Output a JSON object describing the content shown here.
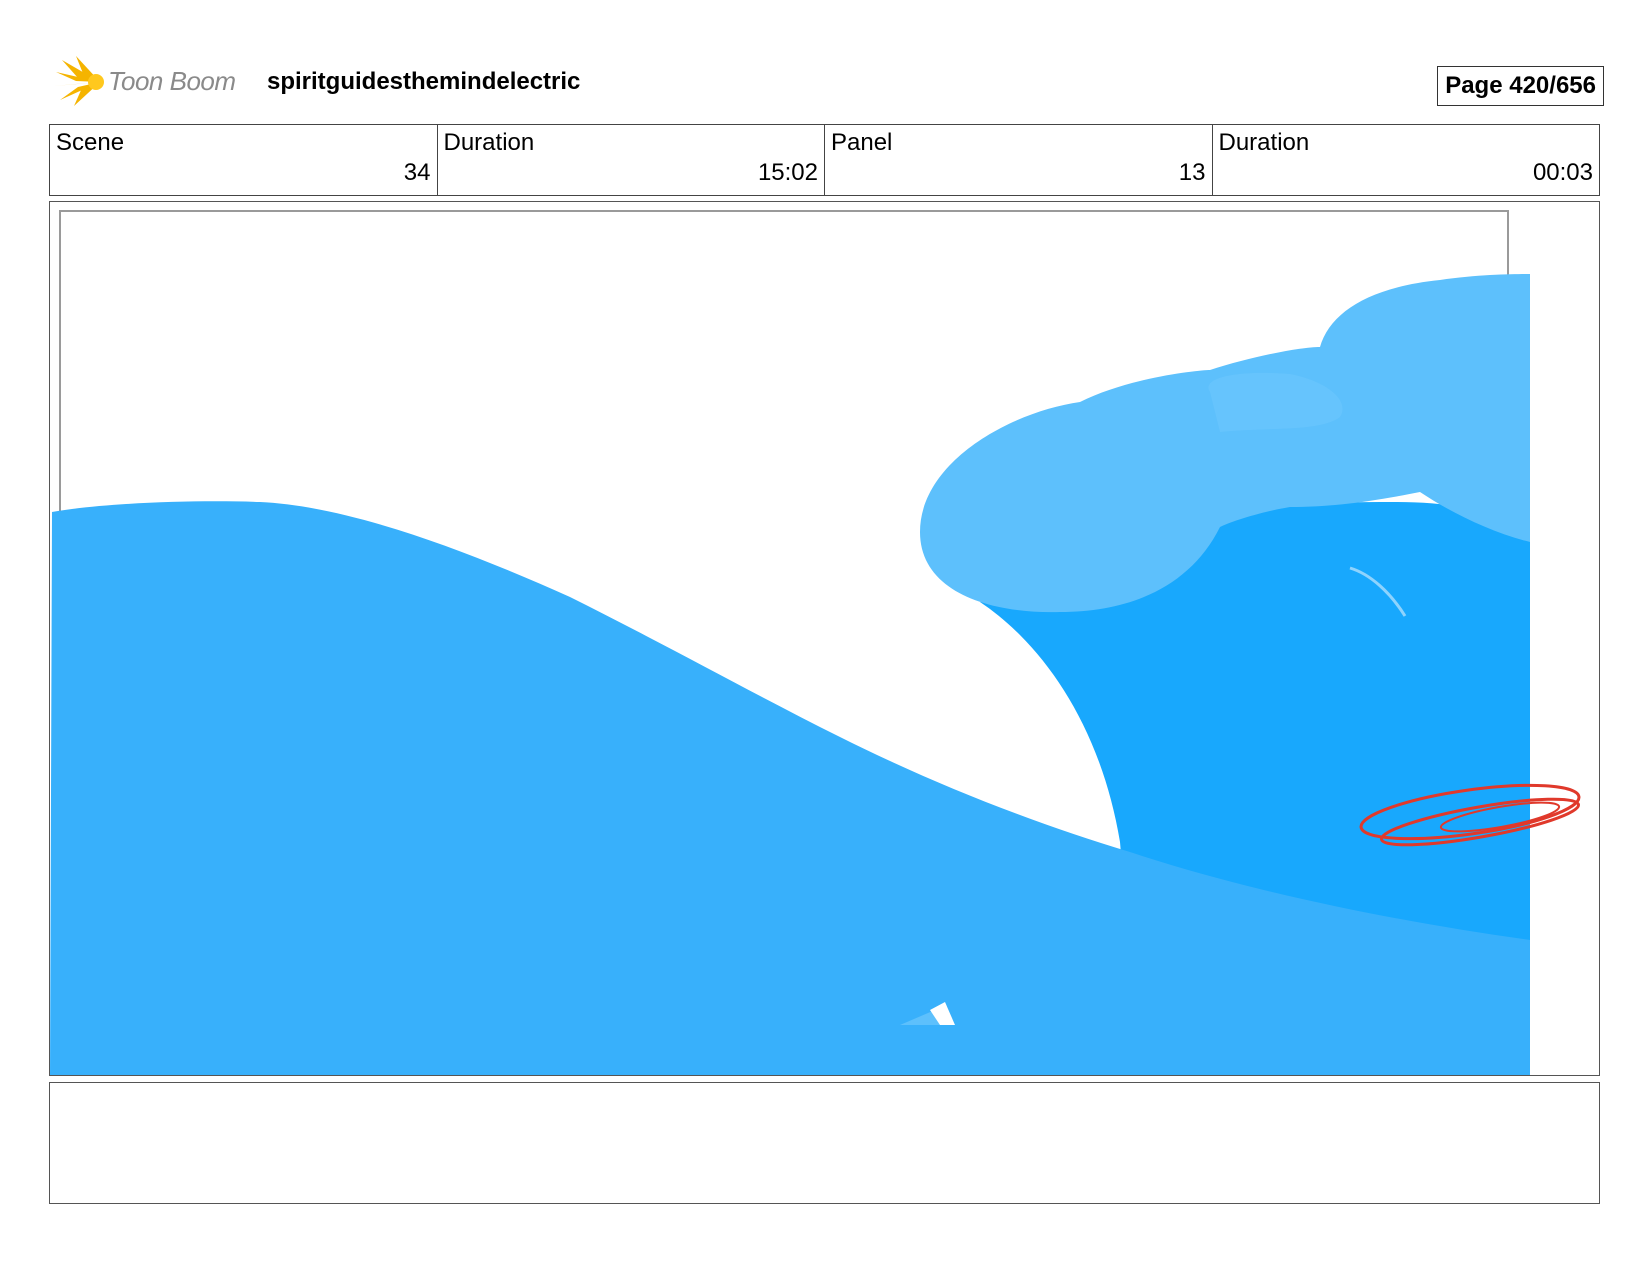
{
  "header": {
    "logo": {
      "text": "Toon Boom",
      "icon": "starburst-logo-icon"
    },
    "project_title": "spiritguidesthemindelectric",
    "page": "Page 420/656"
  },
  "info": {
    "scene_label": "Scene",
    "scene_value": "34",
    "scene_duration_label": "Duration",
    "scene_duration_value": "15:02",
    "panel_label": "Panel",
    "panel_value": "13",
    "panel_duration_label": "Duration",
    "panel_duration_value": "00:03"
  },
  "panel_art": {
    "description_colors": {
      "wave_main": "#38b0fb",
      "wave_light": "#5dc0fc",
      "wave_dark": "#18a8fd",
      "mark_red": "#e0392b"
    }
  },
  "notes": {
    "text": ""
  }
}
